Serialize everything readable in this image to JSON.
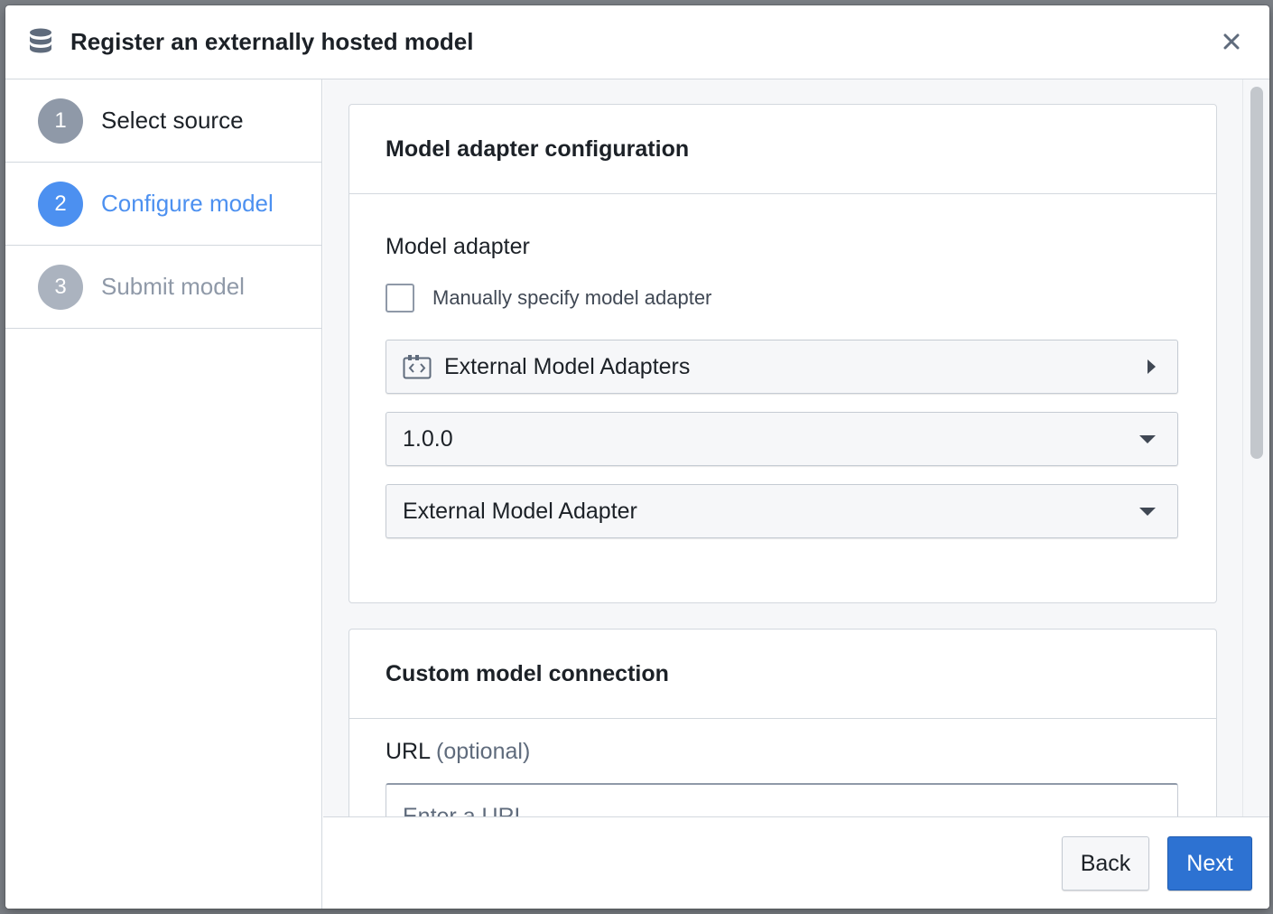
{
  "dialog": {
    "title": "Register an externally hosted model",
    "icon": "database-icon",
    "close_icon": "close-icon"
  },
  "stepper": {
    "steps": [
      {
        "number": "1",
        "label": "Select source",
        "state": "completed"
      },
      {
        "number": "2",
        "label": "Configure model",
        "state": "active"
      },
      {
        "number": "3",
        "label": "Submit model",
        "state": "pending"
      }
    ]
  },
  "adapter_card": {
    "title": "Model adapter configuration",
    "field_label": "Model adapter",
    "manual_checkbox": {
      "label": "Manually specify model adapter",
      "checked": false
    },
    "source_select": {
      "value": "External Model Adapters",
      "icon": "code-file-icon"
    },
    "version_select": {
      "value": "1.0.0"
    },
    "adapter_select": {
      "value": "External Model Adapter"
    }
  },
  "connection_card": {
    "title": "Custom model connection",
    "url_label": "URL",
    "url_optional": "(optional)",
    "url_placeholder": "Enter a URL"
  },
  "footer": {
    "back_label": "Back",
    "next_label": "Next"
  },
  "colors": {
    "primary": "#2d72d2",
    "step_completed": "#8f99a8",
    "step_active": "#4c90f0",
    "step_pending": "#abb3bf",
    "active_text": "#4c90f0",
    "pending_text": "#8f99a8"
  }
}
